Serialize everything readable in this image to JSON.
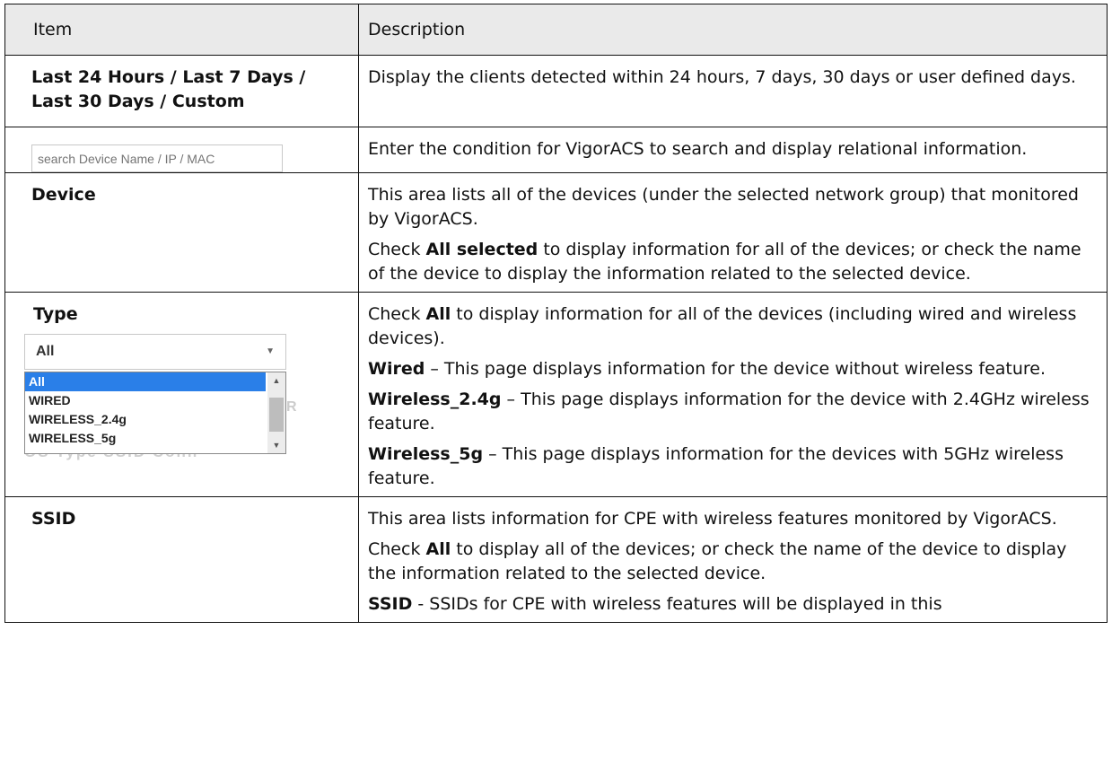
{
  "header": {
    "col_item": "Item",
    "col_desc": "Description"
  },
  "rows": {
    "period": {
      "item": "Last 24 Hours / Last 7 Days / Last 30 Days / Custom",
      "desc": "Display the clients detected within 24 hours, 7 days, 30 days or user defined days."
    },
    "search": {
      "placeholder": "search Device Name / IP / MAC",
      "desc": "Enter the condition for VigorACS to search and display relational information."
    },
    "device": {
      "item": "Device",
      "p1": "This area lists all of the devices (under the selected network group) that monitored by VigorACS.",
      "p2_pre": "Check ",
      "p2_bold": "All selected",
      "p2_post": " to display information for all of the devices; or check the name of the device to display the information related to the selected device."
    },
    "type": {
      "item": "Type",
      "select_value": "All",
      "options": [
        "All",
        "WIRED",
        "WIRELESS_2.4g",
        "WIRELESS_5g"
      ],
      "ghost_text": "OS  Type  SSID  Conn",
      "ghost_r": "R",
      "p1_pre": "Check ",
      "p1_bold": "All",
      "p1_post": " to display information for all of the devices (including wired and wireless devices).",
      "p2_bold": "Wired",
      "p2_post": " – This page displays information for the device without wireless feature.",
      "p3_bold": "Wireless_2.4g",
      "p3_post": " – This page displays information for the device with 2.4GHz wireless feature.",
      "p4_bold": "Wireless_5g",
      "p4_post": " – This page displays information for the devices with 5GHz wireless feature."
    },
    "ssid": {
      "item": "SSID",
      "p1": "This area lists information for CPE with wireless features monitored by VigorACS.",
      "p2_pre": "Check ",
      "p2_bold": "All",
      "p2_post": " to display all of the devices; or check the name of the device to display the information related to the selected device.",
      "p3_bold": "SSID",
      "p3_post": " - SSIDs for CPE with wireless features will be displayed in this"
    }
  }
}
